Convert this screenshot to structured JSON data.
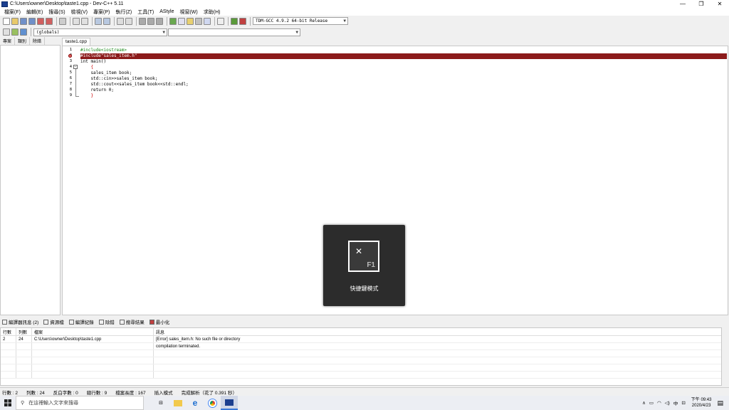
{
  "window": {
    "title": "C:\\Users\\owner\\Desktop\\taste1.cpp - Dev-C++ 5.11"
  },
  "menu": [
    "檔案(F)",
    "編輯(E)",
    "搜尋(S)",
    "檢視(V)",
    "專案(P)",
    "執行(Z)",
    "工具(T)",
    "AStyle",
    "視窗(W)",
    "求助(H)"
  ],
  "toolbar": {
    "compiler": "TDM-GCC 4.9.2 64-bit Release",
    "scope": "(globals)"
  },
  "left_tabs": [
    "專案",
    "類別",
    "除錯"
  ],
  "editor": {
    "tab": "taste1.cpp",
    "lines": [
      {
        "n": "1",
        "text": "#include<iostream>",
        "color": "#1a8a1a"
      },
      {
        "n": "2",
        "text": "#include\"sales_item.h\"",
        "color": "#ffffff"
      },
      {
        "n": "3",
        "text": "int main()",
        "color": "#000000"
      },
      {
        "n": "4",
        "text": "    {",
        "color": "#cc0000"
      },
      {
        "n": "5",
        "text": "    sales_item book;",
        "color": "#000000"
      },
      {
        "n": "6",
        "text": "    std::cin>>sales_item book;",
        "color": "#000000"
      },
      {
        "n": "7",
        "text": "    std::cout<<sales_item book<<std::endl;",
        "color": "#000000"
      },
      {
        "n": "8",
        "text": "    return 0;",
        "color": "#000000"
      },
      {
        "n": "9",
        "text": "    }",
        "color": "#cc0000"
      }
    ]
  },
  "overlay": {
    "label": "快捷鍵模式",
    "key": "F1"
  },
  "bottom_tabs": [
    "編譯器訊息 (2)",
    "資源檔",
    "編譯紀錄",
    "除錯",
    "搜尋結果",
    "最小化"
  ],
  "messages": {
    "headers": [
      "行數",
      "列數",
      "檔案",
      "訊息"
    ],
    "rows": [
      {
        "line": "2",
        "col": "24",
        "file": "C:\\Users\\owner\\Desktop\\taste1.cpp",
        "msg": "[Error] sales_item.h: No such file or directory"
      },
      {
        "line": "",
        "col": "",
        "file": "",
        "msg": "compilation terminated."
      }
    ]
  },
  "status": {
    "line": "行數 :    2",
    "col": "列數 :    24",
    "sel": "反白字數 :    0",
    "total": "總行數 :    9",
    "len": "檔案長度 :    167",
    "mode": "插入模式",
    "parse": "完成解析（花了 0.391 秒）"
  },
  "taskbar": {
    "search_placeholder": "在這裡輸入文字來搜尋",
    "time": "下午 09:43",
    "date": "2020/4/23",
    "ime": "中"
  }
}
